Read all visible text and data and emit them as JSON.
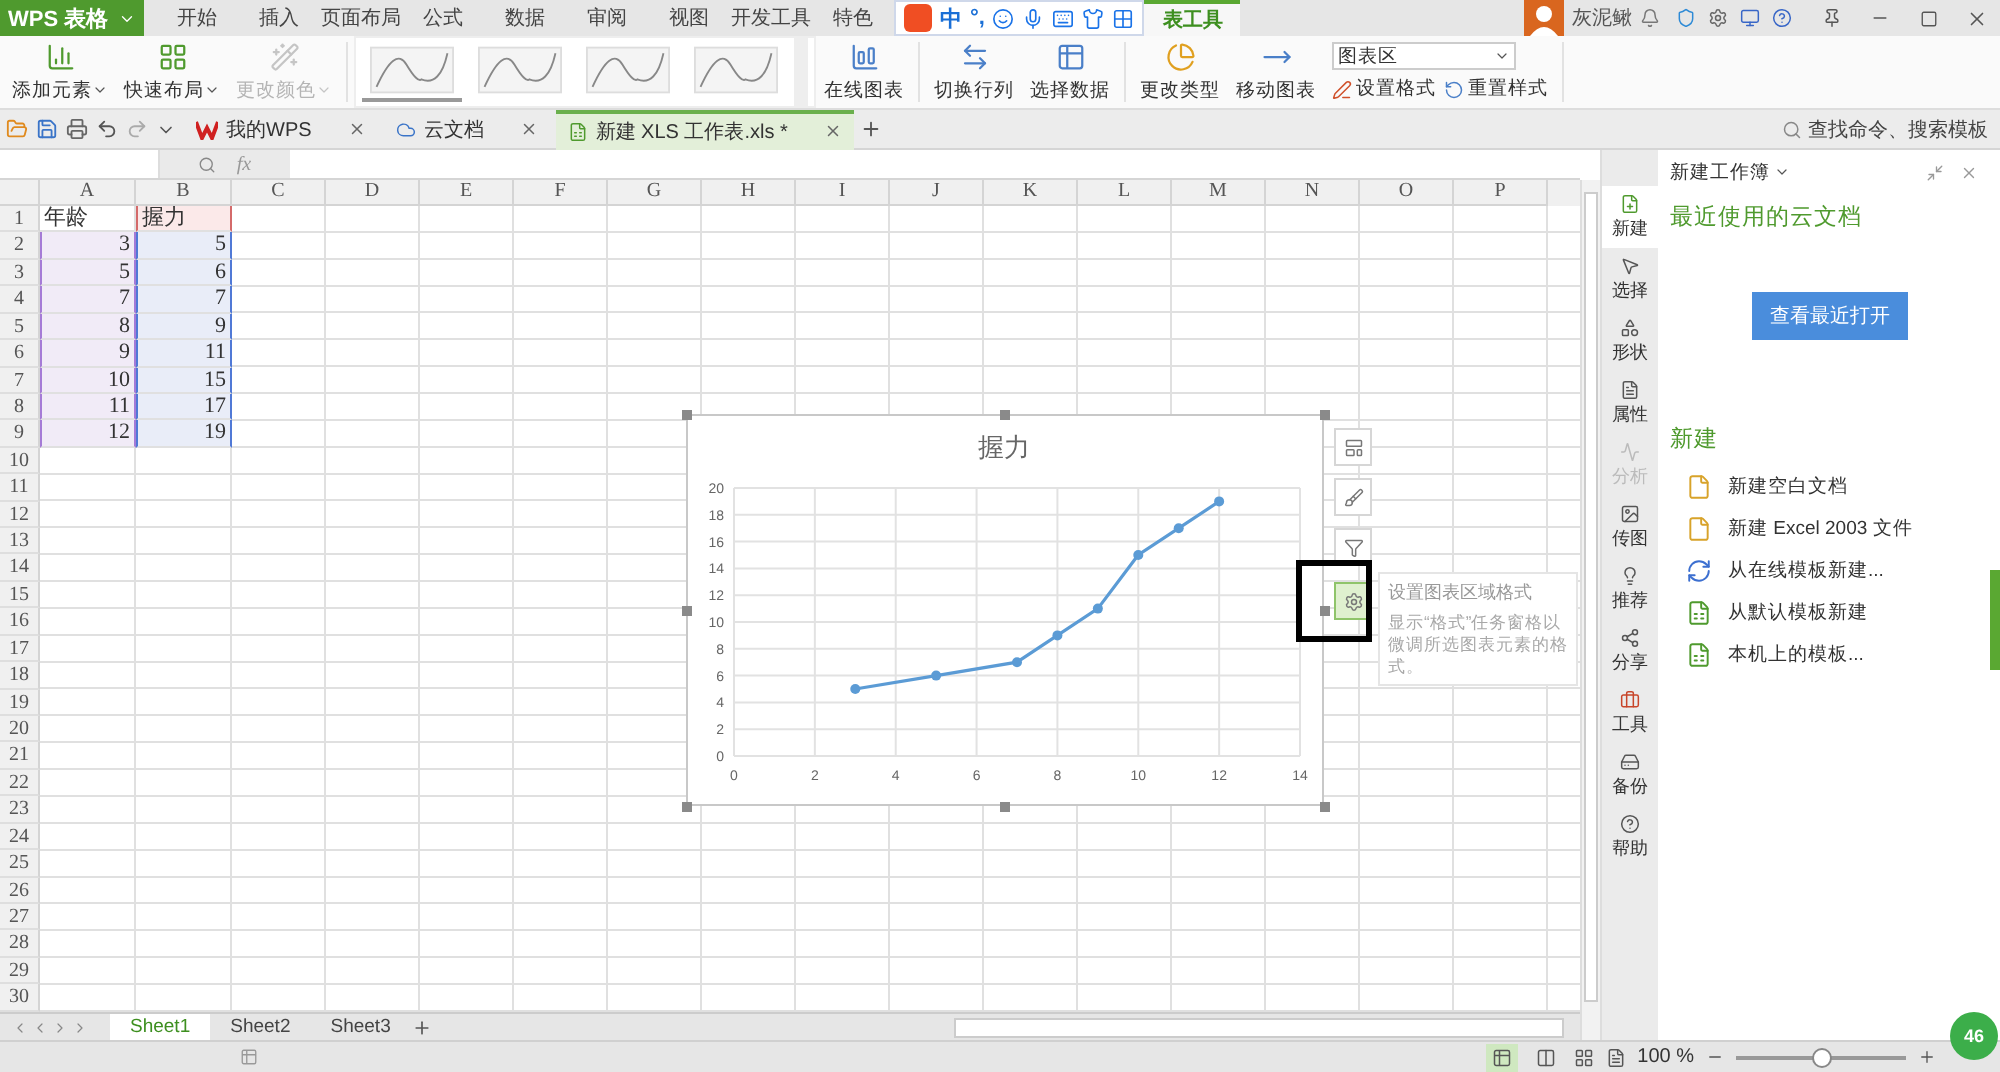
{
  "app_button": "WPS 表格",
  "menu_tabs": [
    {
      "label": "开始",
      "selected": false
    },
    {
      "label": "插入",
      "selected": false
    },
    {
      "label": "页面布局",
      "selected": false
    },
    {
      "label": "公式",
      "selected": false
    },
    {
      "label": "数据",
      "selected": false
    },
    {
      "label": "审阅",
      "selected": false
    },
    {
      "label": "视图",
      "selected": false
    },
    {
      "label": "开发工具",
      "selected": false
    },
    {
      "label": "特色",
      "selected": false
    },
    {
      "label": "表工具",
      "selected": true
    }
  ],
  "ime_toolbar": {
    "mode": "中",
    "punctuation": "°,"
  },
  "user": {
    "name": "灰泥鳅"
  },
  "ribbon": {
    "left_buttons": [
      {
        "label": "添加元素",
        "disabled": false
      },
      {
        "label": "快速布局",
        "disabled": false
      },
      {
        "label": "更改颜色",
        "disabled": true
      }
    ],
    "style_thumbnails": [
      {
        "selected": true
      },
      {
        "selected": false
      },
      {
        "selected": false
      },
      {
        "selected": false
      }
    ],
    "right_buttons": [
      {
        "label": "在线图表"
      },
      {
        "label": "切换行列"
      },
      {
        "label": "选择数据"
      },
      {
        "label": "更改类型"
      },
      {
        "label": "移动图表"
      }
    ],
    "element_select": {
      "value": "图表区"
    },
    "small_buttons": [
      {
        "label": "设置格式"
      },
      {
        "label": "重置样式"
      }
    ]
  },
  "doc_tabs": [
    {
      "label": "我的WPS",
      "selected": false
    },
    {
      "label": "云文档",
      "selected": false
    },
    {
      "label": "新建 XLS 工作表.xls *",
      "selected": true
    }
  ],
  "command_search": {
    "placeholder": "查找命令、搜索模板"
  },
  "formula_bar": {
    "function_label": "fx"
  },
  "sheet": {
    "columns": [
      "A",
      "B",
      "C",
      "D",
      "E",
      "F",
      "G",
      "H",
      "I",
      "J",
      "K",
      "L",
      "M",
      "N",
      "O",
      "P"
    ],
    "row_numbers": [
      "1",
      "2",
      "3",
      "4",
      "5",
      "6",
      "7",
      "8",
      "9",
      "10",
      "11",
      "12",
      "13",
      "14",
      "15",
      "16",
      "17",
      "18",
      "19",
      "20",
      "21",
      "22",
      "23",
      "24",
      "25",
      "26",
      "27",
      "28",
      "29",
      "30"
    ],
    "cells": [
      [
        {
          "text": "年龄",
          "kind": "plain"
        },
        {
          "text": "握力",
          "kind": "series-name"
        }
      ],
      [
        {
          "text": "3",
          "kind": "category"
        },
        {
          "text": "5",
          "kind": "value"
        }
      ],
      [
        {
          "text": "5",
          "kind": "category"
        },
        {
          "text": "6",
          "kind": "value"
        }
      ],
      [
        {
          "text": "7",
          "kind": "category"
        },
        {
          "text": "7",
          "kind": "value"
        }
      ],
      [
        {
          "text": "8",
          "kind": "category"
        },
        {
          "text": "9",
          "kind": "value"
        }
      ],
      [
        {
          "text": "9",
          "kind": "category"
        },
        {
          "text": "11",
          "kind": "value"
        }
      ],
      [
        {
          "text": "10",
          "kind": "category"
        },
        {
          "text": "15",
          "kind": "value"
        }
      ],
      [
        {
          "text": "11",
          "kind": "category"
        },
        {
          "text": "17",
          "kind": "value"
        }
      ],
      [
        {
          "text": "12",
          "kind": "category"
        },
        {
          "text": "19",
          "kind": "value"
        }
      ]
    ]
  },
  "chart": {
    "chart_data": {
      "type": "line",
      "title": "握力",
      "x": [
        3,
        5,
        7,
        8,
        9,
        10,
        11,
        12
      ],
      "series": [
        {
          "color": "#5b9bd5",
          "marker": true,
          "values": [
            5,
            6,
            7,
            9,
            11,
            15,
            17,
            19
          ]
        }
      ],
      "xlim": [
        0,
        14
      ],
      "ylim": [
        0,
        20
      ],
      "xticks": [
        0,
        2,
        4,
        6,
        8,
        10,
        12,
        14
      ],
      "yticks": [
        0,
        2,
        4,
        6,
        8,
        10,
        12,
        14,
        16,
        18,
        20
      ],
      "grid": true
    }
  },
  "chart_side_buttons": [
    {
      "selected": false
    },
    {
      "selected": false
    },
    {
      "selected": false
    },
    {
      "selected": true
    }
  ],
  "tooltip": {
    "title": "设置图表区域格式",
    "body": "显示“格式”任务窗格以微调所选图表元素的格式。"
  },
  "side_nav": [
    {
      "label": "新建",
      "selected": true,
      "disabled": false
    },
    {
      "label": "选择",
      "selected": false,
      "disabled": false
    },
    {
      "label": "形状",
      "selected": false,
      "disabled": false
    },
    {
      "label": "属性",
      "selected": false,
      "disabled": false
    },
    {
      "label": "分析",
      "selected": false,
      "disabled": true
    },
    {
      "label": "传图",
      "selected": false,
      "disabled": false
    },
    {
      "label": "推荐",
      "selected": false,
      "disabled": false
    },
    {
      "label": "分享",
      "selected": false,
      "disabled": false
    },
    {
      "label": "工具",
      "selected": false,
      "disabled": false
    },
    {
      "label": "备份",
      "selected": false,
      "disabled": false
    },
    {
      "label": "帮助",
      "selected": false,
      "disabled": false
    }
  ],
  "task_pane": {
    "title": "新建工作簿",
    "recent_heading": "最近使用的云文档",
    "recent_button": "查看最近打开",
    "new_heading": "新建",
    "new_items": [
      "新建空白文档",
      "新建 Excel 2003 文件",
      "从在线模板新建...",
      "从默认模板新建",
      "本机上的模板..."
    ]
  },
  "sheet_tabs": [
    {
      "label": "Sheet1",
      "selected": true
    },
    {
      "label": "Sheet2",
      "selected": false
    },
    {
      "label": "Sheet3",
      "selected": false
    }
  ],
  "status_bar": {
    "view_buttons": [
      {
        "selected": true
      },
      {
        "selected": false
      }
    ],
    "zoom_label": "100 %",
    "zoom": {
      "level": 0.5
    }
  },
  "speed_ball": {
    "value": "46"
  }
}
